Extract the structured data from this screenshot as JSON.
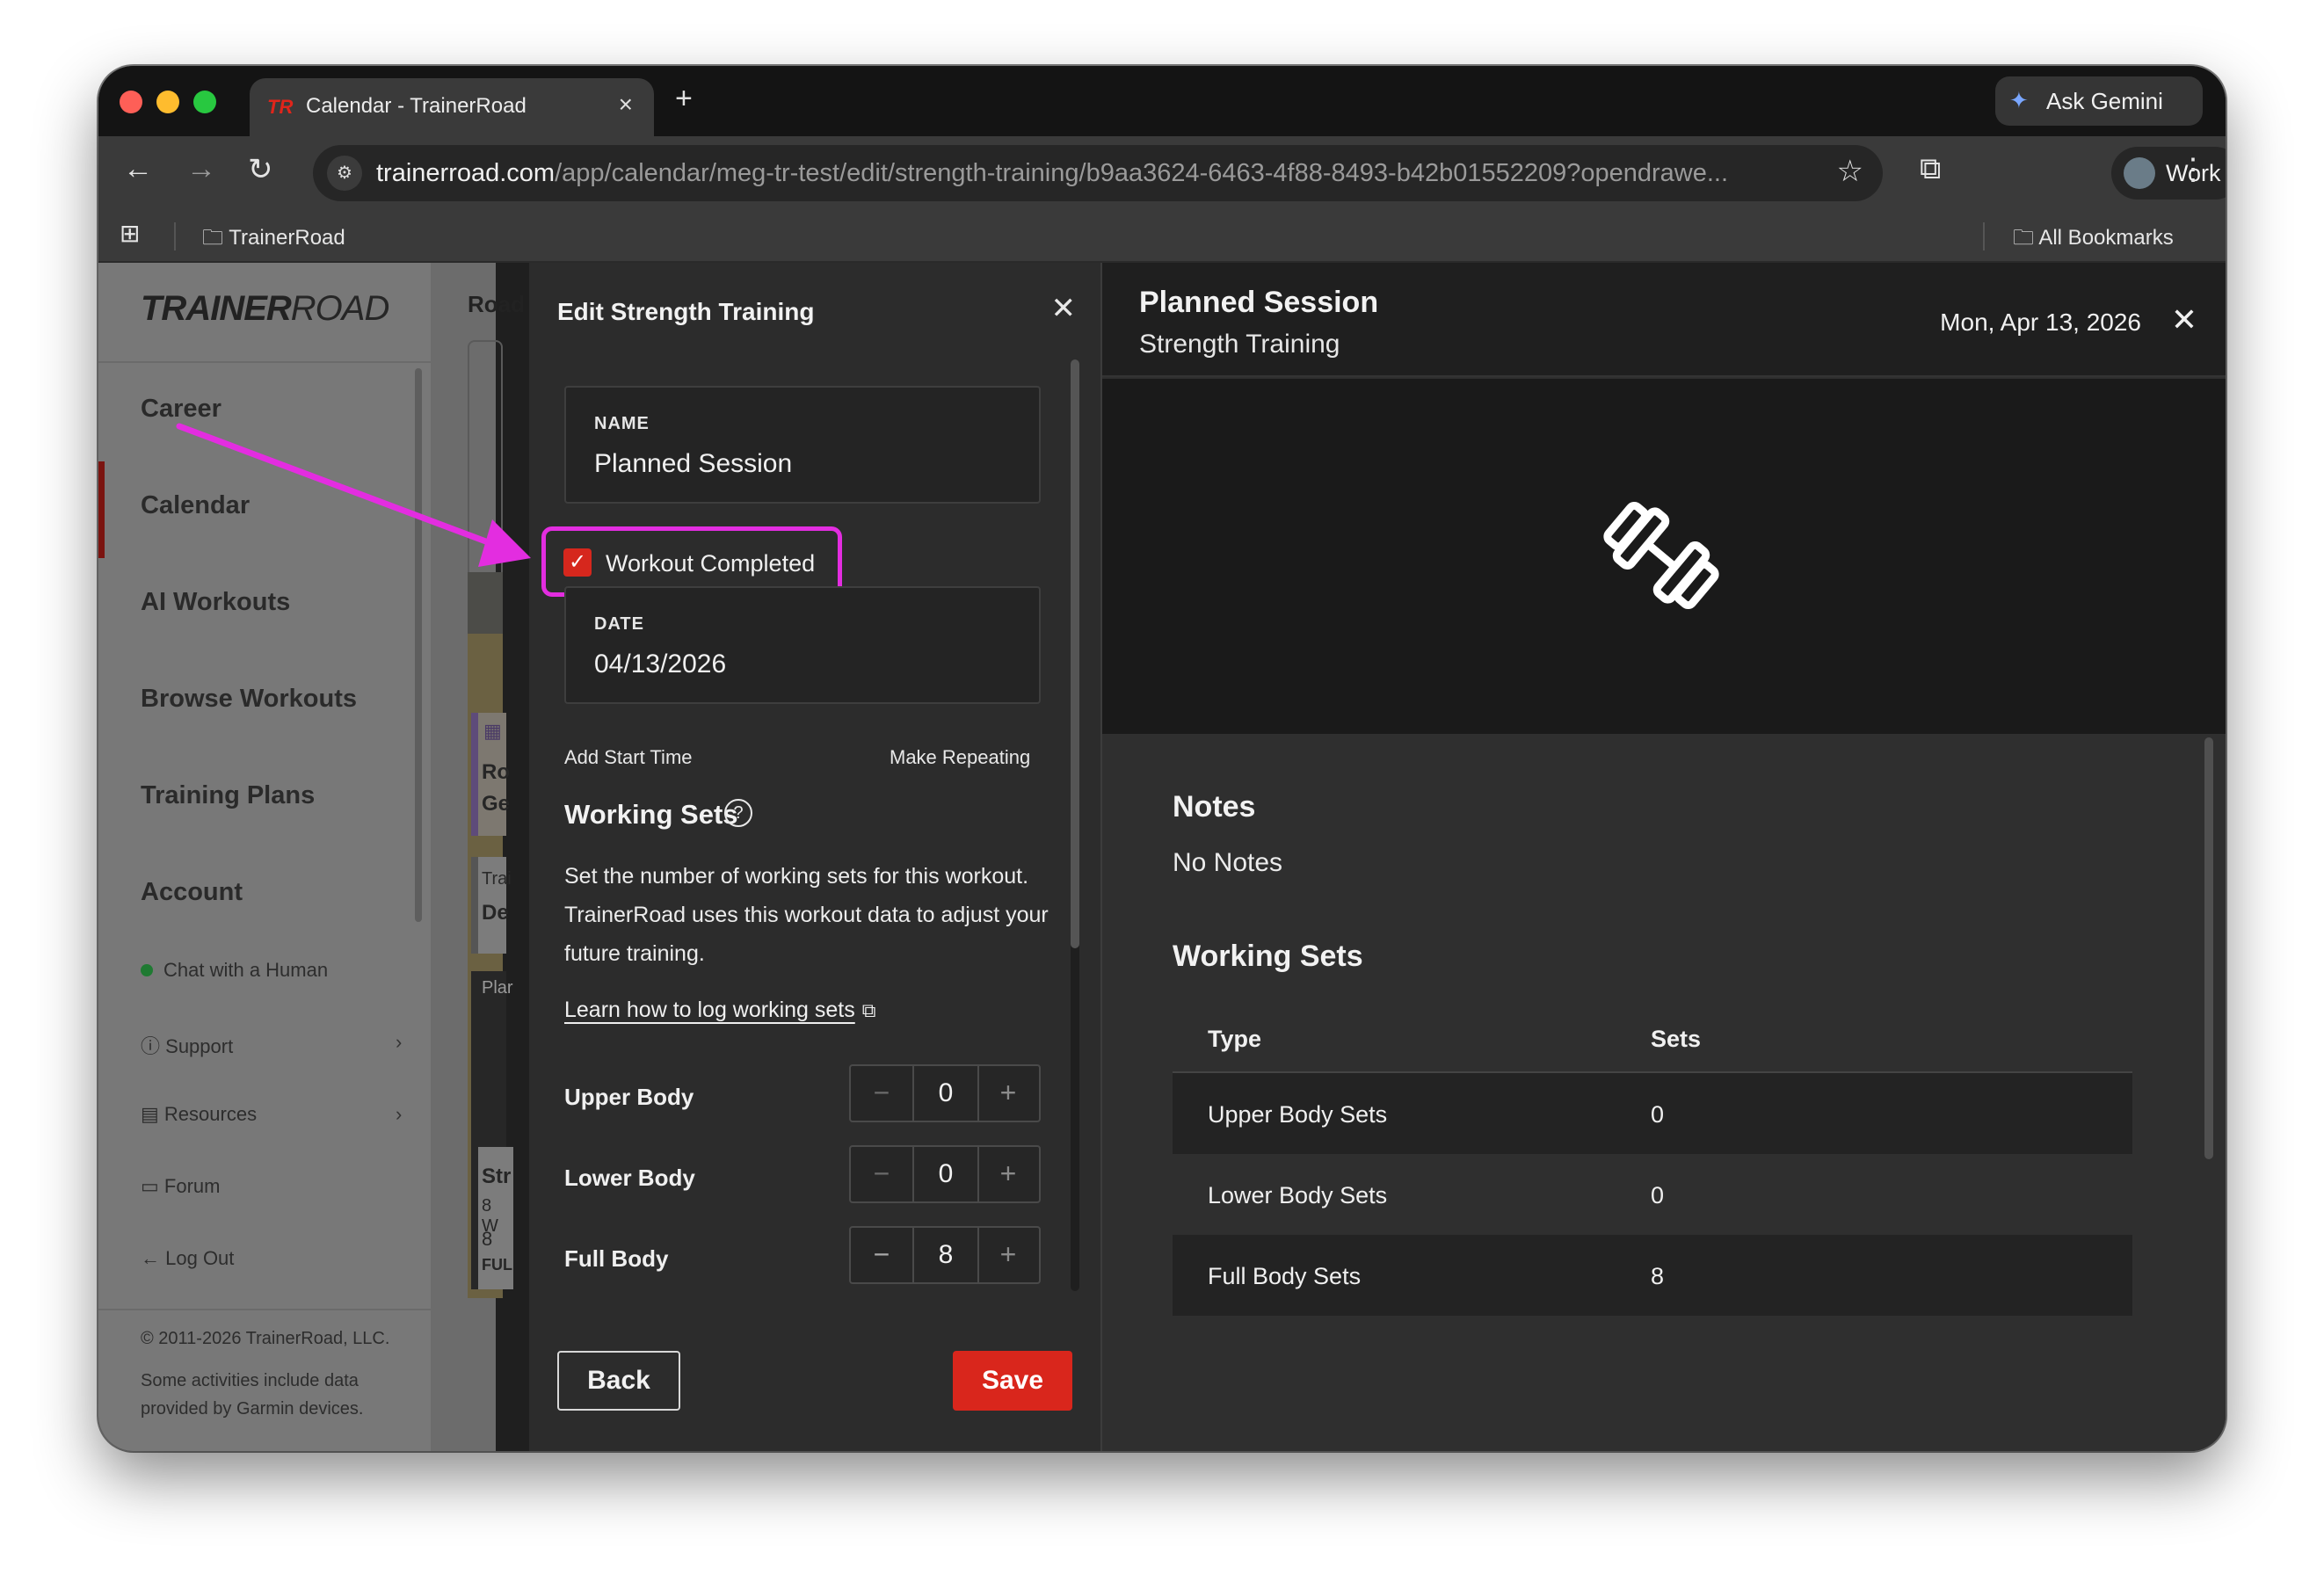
{
  "browser": {
    "tab_title": "Calendar - TrainerRoad",
    "tab_logo": "TR",
    "new_tab": "+",
    "tab_close": "×",
    "ask_gemini": "Ask Gemini",
    "url_domain": "trainerroad.com",
    "url_path": "/app/calendar/meg-tr-test/edit/strength-training/b9aa3624-6463-4f88-8493-b42b01552209?opendrawe...",
    "profile": "Work",
    "bookmark_folder": "TrainerRoad",
    "all_bookmarks": "All Bookmarks"
  },
  "sidebar": {
    "logo_bold": "TRAINER",
    "logo_light": "ROAD",
    "nav": [
      "Career",
      "Calendar",
      "AI Workouts",
      "Browse Workouts",
      "Training Plans",
      "Account"
    ],
    "chat": "Chat with a Human",
    "support": "Support",
    "resources": "Resources",
    "forum": "Forum",
    "logout": "Log Out",
    "copyright": "© 2011-2026 TrainerRoad, LLC.",
    "garmin": "Some activities include data provided by Garmin devices."
  },
  "calendar": {
    "road_label": "Road",
    "card_1_line1": "Ro",
    "card_1_line2": "Ge",
    "card_2_line1": "Trai",
    "card_2_line2": "De",
    "card_3_label": "Plar",
    "card_4_line1": "Str",
    "card_4_line2": "8 W",
    "card_4_line3": "8",
    "card_4_line4": "FUL"
  },
  "edit": {
    "header": "Edit Strength Training",
    "name_label": "NAME",
    "name_value": "Planned Session",
    "completed_label": "Workout Completed",
    "completed": true,
    "date_label": "DATE",
    "date_value": "04/13/2026",
    "add_start_time": "Add Start Time",
    "make_repeating": "Make Repeating",
    "ws_title": "Working Sets",
    "ws_desc": "Set the number of working sets for this workout. TrainerRoad uses this workout data to adjust your future training.",
    "ws_learn": "Learn how to log working sets",
    "sets": [
      {
        "label": "Upper Body",
        "value": "0"
      },
      {
        "label": "Lower Body",
        "value": "0"
      },
      {
        "label": "Full Body",
        "value": "8"
      }
    ],
    "back": "Back",
    "save": "Save"
  },
  "detail": {
    "title": "Planned Session",
    "subtitle": "Strength Training",
    "date": "Mon, Apr 13, 2026",
    "notes_title": "Notes",
    "notes_value": "No Notes",
    "ws_title": "Working Sets",
    "col_type": "Type",
    "col_sets": "Sets",
    "rows": [
      {
        "type": "Upper Body Sets",
        "sets": "0"
      },
      {
        "type": "Lower Body Sets",
        "sets": "0"
      },
      {
        "type": "Full Body Sets",
        "sets": "8"
      }
    ]
  },
  "colors": {
    "accent_red": "#d9261c",
    "annotation_magenta": "#e32de0"
  }
}
